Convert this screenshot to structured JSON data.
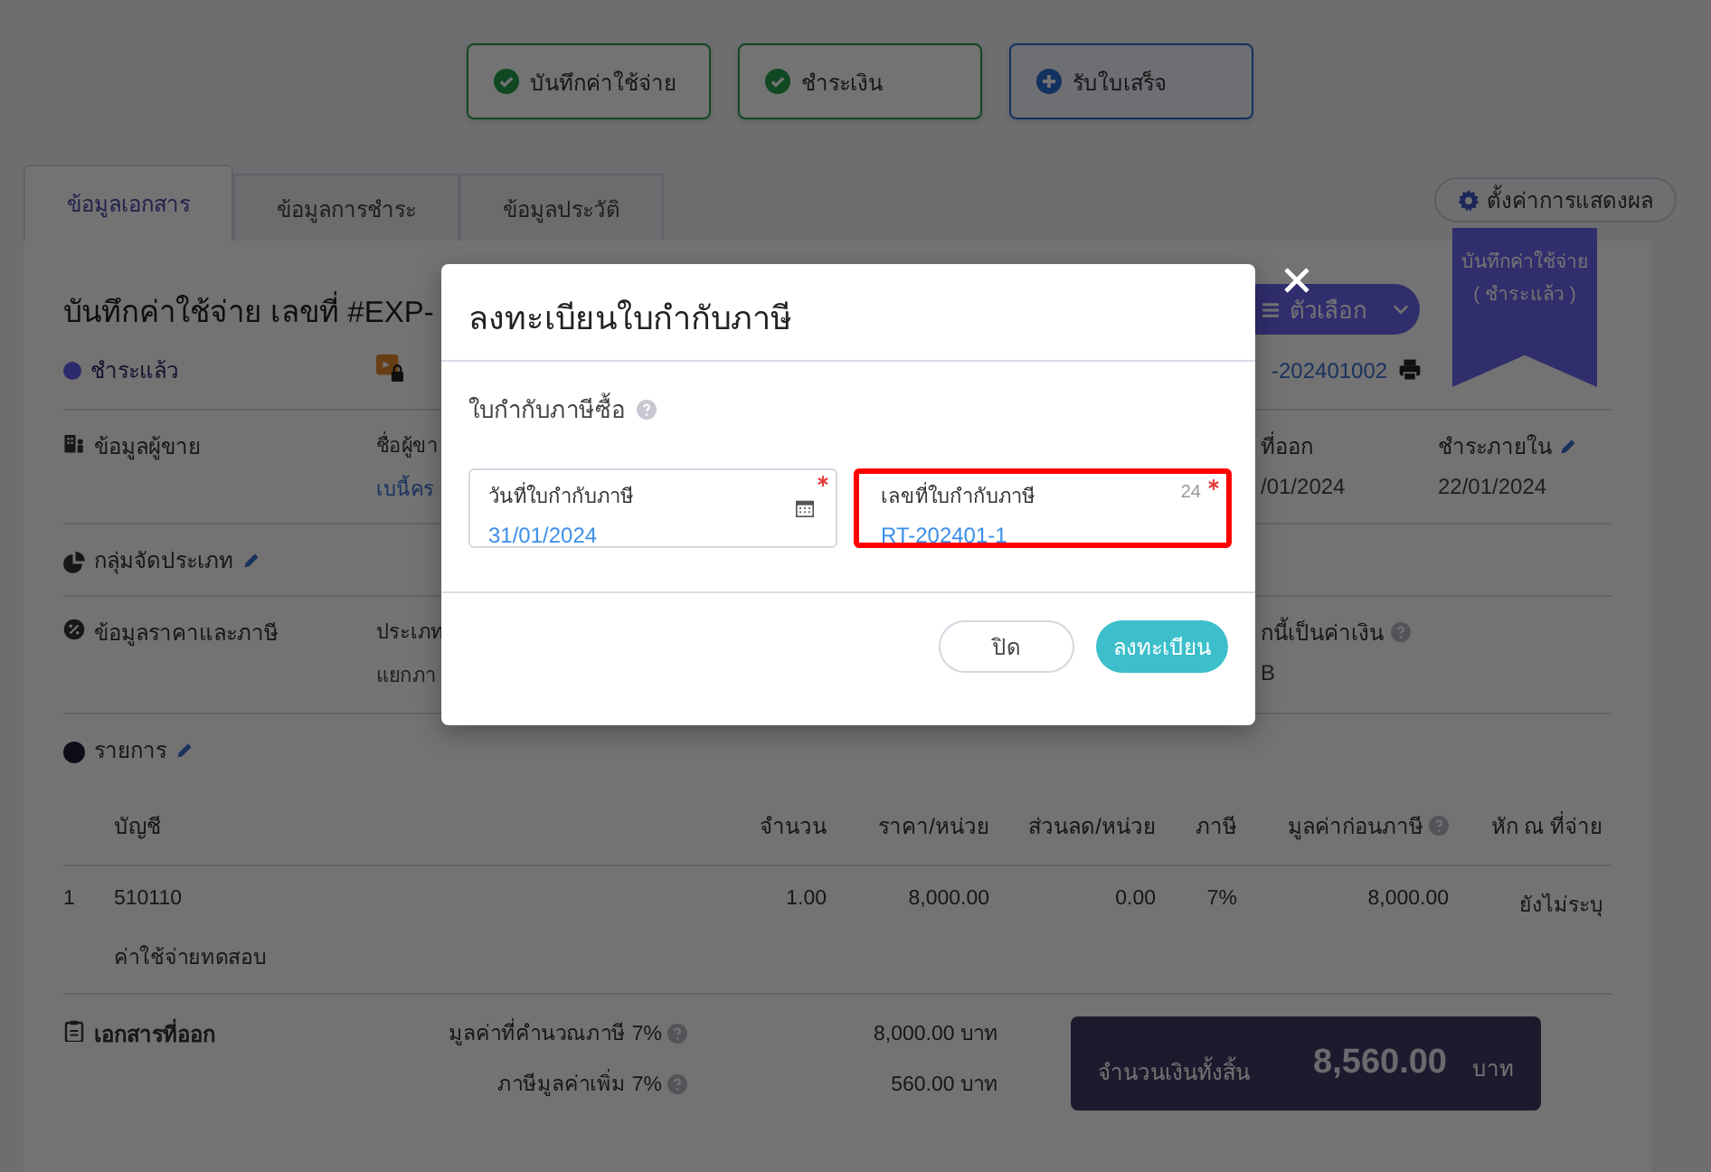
{
  "steps": [
    {
      "label": "บันทึกค่าใช้จ่าย",
      "completed": true
    },
    {
      "label": "ชำระเงิน",
      "completed": true
    },
    {
      "label": "รับใบเสร็จ",
      "completed": false
    }
  ],
  "tabs": [
    {
      "label": "ข้อมูลเอกสาร",
      "selected": true
    },
    {
      "label": "ข้อมูลการชำระ",
      "selected": false
    },
    {
      "label": "ข้อมูลประวัติ",
      "selected": false
    }
  ],
  "display_settings_button": "ตั้งค่าการแสดงผล",
  "ribbon": {
    "line_1": "บันทึกค่าใช้จ่าย",
    "line_2": "( ชำระแล้ว )"
  },
  "document": {
    "title": "บันทึกค่าใช้จ่าย เลขที่ #EXP-",
    "options_button": "ตัวเลือก",
    "status": {
      "label": "ชำระแล้ว",
      "color": "#2c2a6a"
    },
    "reference": "-202401002",
    "seller": {
      "heading": "ข้อมูลผู้ขาย",
      "vendor_label": "ชื่อผู้ขา",
      "vendor_name": "เบนี้คร",
      "issue_date_label": "ที่ออก",
      "issue_date": "/01/2024",
      "due_label": "ชำระภายใน",
      "due_date": "22/01/2024"
    },
    "category": {
      "heading": "กลุ่มจัดประเภท"
    },
    "pricing": {
      "heading": "ข้อมูลราคาและภาษี",
      "price_type_label": "ประเภท",
      "price_type": "แยกภา",
      "currency_label": "กนี้เป็นค่าเงิน",
      "currency": "B"
    },
    "items": {
      "heading": "รายการ",
      "columns": [
        "บัญชี",
        "จำนวน",
        "ราคา/หน่วย",
        "ส่วนลด/หน่วย",
        "ภาษี",
        "มูลค่าก่อนภาษี",
        "หัก ณ ที่จ่าย"
      ],
      "rows": [
        {
          "no": "1",
          "account": "510110",
          "description": "ค่าใช้จ่ายทดสอบ",
          "quantity": "1.00",
          "unit_price": "8,000.00",
          "discount": "0.00",
          "tax": "7%",
          "pre_tax": "8,000.00",
          "withholding": "ยังไม่ระบุ"
        }
      ]
    },
    "footer": {
      "heading": "เอกสารที่ออก",
      "summary": [
        {
          "label": "มูลค่าที่คำนวณภาษี 7%",
          "value": "8,000.00 บาท"
        },
        {
          "label": "ภาษีมูลค่าเพิ่ม 7%",
          "value": "560.00 บาท"
        }
      ],
      "total": {
        "label": "จำนวนเงินทั้งสิ้น",
        "amount": "8,560.00",
        "unit": "บาท"
      }
    }
  },
  "dialog": {
    "title": "ลงทะเบียนใบกำกับภาษี",
    "section_label": "ใบกำกับภาษีซื้อ",
    "fields": [
      {
        "kind": "date",
        "label": "วันที่ใบกำกับภาษี",
        "value": "31/01/2024",
        "required": true,
        "highlighted": false
      },
      {
        "kind": "text",
        "label": "เลขที่ใบกำกับภาษี",
        "value": "RT-202401-1",
        "counter": "24",
        "required": true,
        "highlighted": true
      }
    ],
    "close_button": "ปิด",
    "submit_button": "ลงทะเบียน"
  }
}
